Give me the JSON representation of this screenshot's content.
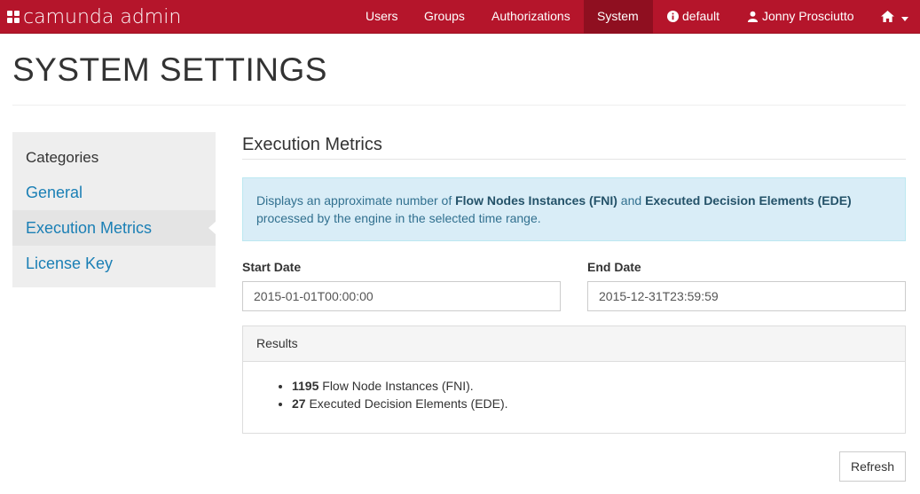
{
  "navbar": {
    "brand": "camunda admin",
    "items": [
      {
        "label": "Users"
      },
      {
        "label": "Groups"
      },
      {
        "label": "Authorizations"
      },
      {
        "label": "System"
      }
    ],
    "engine": "default",
    "user": "Jonny Prosciutto",
    "accent_color": "#b5152b"
  },
  "page": {
    "title": "SYSTEM SETTINGS"
  },
  "sidebar": {
    "heading": "Categories",
    "items": [
      {
        "label": "General"
      },
      {
        "label": "Execution Metrics"
      },
      {
        "label": "License Key"
      }
    ],
    "active": "Execution Metrics"
  },
  "main": {
    "section_title": "Execution Metrics",
    "info": {
      "prefix": "Displays an approximate number of ",
      "fni": "Flow Nodes Instances (FNI)",
      "and": " and ",
      "ede": "Executed Decision Elements (EDE)",
      "suffix": "processed by the engine in the selected time range."
    },
    "start_date_label": "Start Date",
    "start_date_value": "2015-01-01T00:00:00",
    "end_date_label": "End Date",
    "end_date_value": "2015-12-31T23:59:59",
    "results_heading": "Results",
    "results": [
      {
        "count": "1195",
        "text": " Flow Node Instances (FNI)."
      },
      {
        "count": "27",
        "text": " Executed Decision Elements (EDE)."
      }
    ],
    "refresh_label": "Refresh"
  }
}
